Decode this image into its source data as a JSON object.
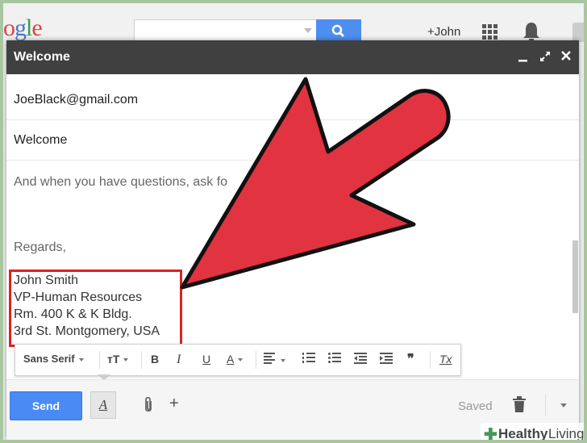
{
  "google": {
    "logo_text": "Google",
    "user_name": "+John"
  },
  "compose": {
    "title": "Welcome",
    "to_value": "JoeBlack@gmail.com",
    "subject_value": "Welcome",
    "body_line1": "And when you have questions, ask fo",
    "regards": "Regards,",
    "signature": {
      "line1": "John Smith",
      "line2": "VP-Human Resources",
      "line3": "Rm. 400 K & K Bldg.",
      "line4": "3rd St.  Montgomery, USA"
    }
  },
  "format_toolbar": {
    "font_family": "Sans Serif",
    "size_label": "тT",
    "bold": "B",
    "italic": "I",
    "underline": "U",
    "text_color": "A",
    "quote": "❞",
    "clear": "Tx"
  },
  "bottom_bar": {
    "send_label": "Send",
    "format_label": "A",
    "insert_label": "+",
    "status": "Saved"
  },
  "watermark": {
    "brand_bold": "Healthy",
    "brand_regular": "Living"
  },
  "colors": {
    "header_bg": "#404040",
    "send_button": "#4a8af4",
    "highlight_box": "#e02020",
    "arrow_fill": "#e23340"
  },
  "icons": [
    "search-icon",
    "apps-icon",
    "bell-icon",
    "minimize-icon",
    "popout-icon",
    "close-icon",
    "attach-icon",
    "trash-icon",
    "arrow-annotation"
  ]
}
